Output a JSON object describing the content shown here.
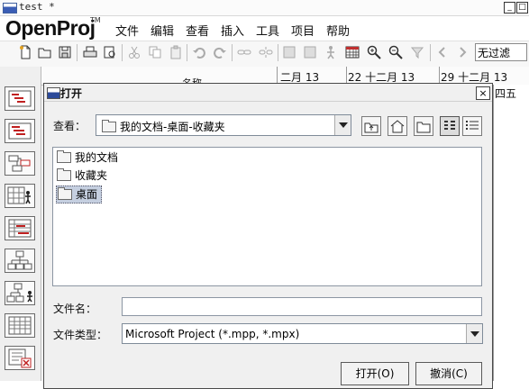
{
  "window": {
    "title": "test *",
    "minimize_label": "_",
    "maximize_label": "□"
  },
  "app": {
    "logo": "OpenProj",
    "logo_tm": "TM"
  },
  "menu": [
    "文件",
    "编辑",
    "查看",
    "插入",
    "工具",
    "项目",
    "帮助"
  ],
  "toolbar": {
    "icons": [
      "new-document-icon",
      "open-folder-icon",
      "save-icon",
      "print-icon",
      "print-preview-icon",
      "cut-icon",
      "copy-icon",
      "paste-icon",
      "undo-icon",
      "redo-icon",
      "link-icon",
      "unlink-icon",
      "task-info-icon",
      "task-notes-icon",
      "assign-resources-icon",
      "calendar-icon",
      "zoom-in-icon",
      "zoom-out-icon",
      "filter-icon",
      "scroll-left-icon",
      "scroll-right-icon"
    ],
    "filter_value": "无过滤"
  },
  "gantt_header": {
    "name_column": "名称",
    "weeks": [
      "二月 13",
      "22 十二月 13",
      "29 十二月 13"
    ],
    "right_pane": "四五"
  },
  "dialog": {
    "title": "打开",
    "close_label": "×",
    "look_in_label": "查看：",
    "look_in_value": "我的文档-桌面-收藏夹",
    "nav_buttons": [
      "up-one-level-icon",
      "home-icon",
      "new-folder-icon",
      "list-view-icon",
      "details-view-icon"
    ],
    "files": [
      {
        "name": "我的文档",
        "selected": false
      },
      {
        "name": "收藏夹",
        "selected": false
      },
      {
        "name": "桌面",
        "selected": true
      }
    ],
    "file_name_label": "文件名：",
    "file_name_value": "",
    "file_type_label": "文件类型：",
    "file_type_value": "Microsoft Project (*.mpp, *.mpx)",
    "open_button": "打开(O)",
    "cancel_button": "撤消(C)"
  }
}
